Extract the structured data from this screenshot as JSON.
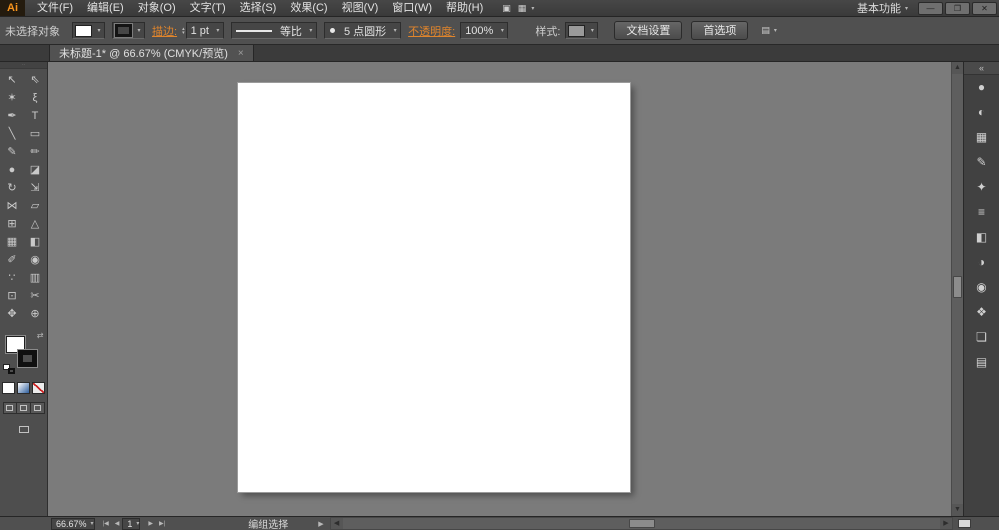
{
  "colors": {
    "accent_orange": "#e0852c",
    "logo_orange": "#f7941d",
    "canvas_background": "#7b7b7b",
    "artboard": "#ffffff",
    "ui_chrome": "#505050"
  },
  "icons": {
    "caret": "▾",
    "stepper_up": "▴",
    "stepper_down": "▾",
    "grid": "▦",
    "bridge": "▣",
    "panel_menu": "▤",
    "collapse": "«",
    "swap": "⇄",
    "scroll_up": "▲",
    "scroll_down": "▼",
    "scroll_left": "◀",
    "scroll_right": "▶",
    "nav_first": "|◀",
    "nav_prev": "◀",
    "nav_next": "▶",
    "nav_last": "▶|"
  },
  "titlebar": {
    "logo": "Ai",
    "menus": [
      "文件(F)",
      "编辑(E)",
      "对象(O)",
      "文字(T)",
      "选择(S)",
      "效果(C)",
      "视图(V)",
      "窗口(W)",
      "帮助(H)"
    ],
    "workspace": "基本功能",
    "window": {
      "minimize": "—",
      "restore": "❐",
      "close": "✕"
    }
  },
  "controlbar": {
    "selection_status": "未选择对象",
    "stroke_link": "描边:",
    "stroke_width": "1 pt",
    "profile_label": "等比",
    "brush_name": "5 点圆形",
    "opacity_link": "不透明度:",
    "opacity_value": "100%",
    "style_label": "样式:",
    "doc_setup": "文档设置",
    "preferences": "首选项"
  },
  "tabbar": {
    "tab_title": "未标题-1* @ 66.67% (CMYK/预览)",
    "close": "×"
  },
  "tools": [
    {
      "name": "selection-tool",
      "glyph": "↖"
    },
    {
      "name": "direct-selection-tool",
      "glyph": "⇖"
    },
    {
      "name": "magic-wand-tool",
      "glyph": "✶"
    },
    {
      "name": "lasso-tool",
      "glyph": "ξ"
    },
    {
      "name": "pen-tool",
      "glyph": "✒"
    },
    {
      "name": "type-tool",
      "glyph": "T"
    },
    {
      "name": "line-segment-tool",
      "glyph": "╲"
    },
    {
      "name": "rectangle-tool",
      "glyph": "▭"
    },
    {
      "name": "paintbrush-tool",
      "glyph": "✎"
    },
    {
      "name": "pencil-tool",
      "glyph": "✏"
    },
    {
      "name": "blob-brush-tool",
      "glyph": "●"
    },
    {
      "name": "eraser-tool",
      "glyph": "◪"
    },
    {
      "name": "rotate-tool",
      "glyph": "↻"
    },
    {
      "name": "scale-tool",
      "glyph": "⇲"
    },
    {
      "name": "width-tool",
      "glyph": "⋈"
    },
    {
      "name": "free-transform-tool",
      "glyph": "▱"
    },
    {
      "name": "shape-builder-tool",
      "glyph": "⊞"
    },
    {
      "name": "perspective-grid-tool",
      "glyph": "△"
    },
    {
      "name": "mesh-tool",
      "glyph": "▦"
    },
    {
      "name": "gradient-tool",
      "glyph": "◧"
    },
    {
      "name": "eyedropper-tool",
      "glyph": "✐"
    },
    {
      "name": "blend-tool",
      "glyph": "◉"
    },
    {
      "name": "symbol-sprayer-tool",
      "glyph": "∵"
    },
    {
      "name": "column-graph-tool",
      "glyph": "▥"
    },
    {
      "name": "artboard-tool",
      "glyph": "⊡"
    },
    {
      "name": "slice-tool",
      "glyph": "✂"
    },
    {
      "name": "hand-tool",
      "glyph": "✥"
    },
    {
      "name": "zoom-tool",
      "glyph": "⊕"
    }
  ],
  "panels": [
    {
      "name": "color-panel",
      "glyph": "●"
    },
    {
      "name": "color-guide-panel",
      "glyph": "◐"
    },
    {
      "name": "swatches-panel",
      "glyph": "▦"
    },
    {
      "name": "brushes-panel",
      "glyph": "✎"
    },
    {
      "name": "symbols-panel",
      "glyph": "✦"
    },
    {
      "name": "stroke-panel",
      "glyph": "≡"
    },
    {
      "name": "gradient-panel",
      "glyph": "◧"
    },
    {
      "name": "transparency-panel",
      "glyph": "◑"
    },
    {
      "name": "appearance-panel",
      "glyph": "◉"
    },
    {
      "name": "graphic-styles-panel",
      "glyph": "❖"
    },
    {
      "name": "layers-panel",
      "glyph": "❏"
    },
    {
      "name": "artboards-panel",
      "glyph": "▤"
    }
  ],
  "statusbar": {
    "zoom": "66.67%",
    "artboard_number": "1",
    "status_text": "编组选择",
    "status_popup": "▶"
  }
}
